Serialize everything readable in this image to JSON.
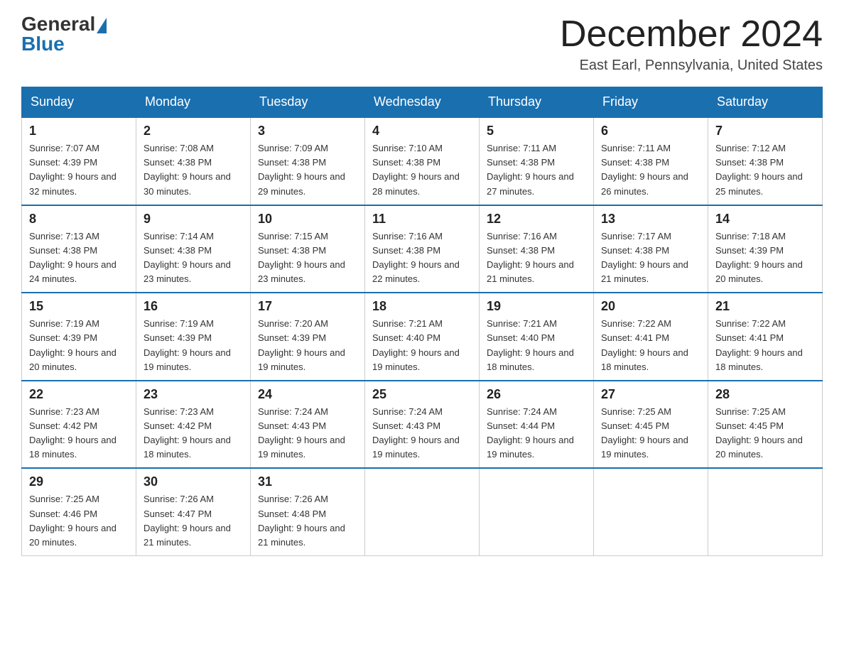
{
  "logo": {
    "general": "General",
    "blue": "Blue"
  },
  "title": "December 2024",
  "location": "East Earl, Pennsylvania, United States",
  "days_of_week": [
    "Sunday",
    "Monday",
    "Tuesday",
    "Wednesday",
    "Thursday",
    "Friday",
    "Saturday"
  ],
  "weeks": [
    [
      {
        "day": "1",
        "sunrise": "7:07 AM",
        "sunset": "4:39 PM",
        "daylight": "9 hours and 32 minutes."
      },
      {
        "day": "2",
        "sunrise": "7:08 AM",
        "sunset": "4:38 PM",
        "daylight": "9 hours and 30 minutes."
      },
      {
        "day": "3",
        "sunrise": "7:09 AM",
        "sunset": "4:38 PM",
        "daylight": "9 hours and 29 minutes."
      },
      {
        "day": "4",
        "sunrise": "7:10 AM",
        "sunset": "4:38 PM",
        "daylight": "9 hours and 28 minutes."
      },
      {
        "day": "5",
        "sunrise": "7:11 AM",
        "sunset": "4:38 PM",
        "daylight": "9 hours and 27 minutes."
      },
      {
        "day": "6",
        "sunrise": "7:11 AM",
        "sunset": "4:38 PM",
        "daylight": "9 hours and 26 minutes."
      },
      {
        "day": "7",
        "sunrise": "7:12 AM",
        "sunset": "4:38 PM",
        "daylight": "9 hours and 25 minutes."
      }
    ],
    [
      {
        "day": "8",
        "sunrise": "7:13 AM",
        "sunset": "4:38 PM",
        "daylight": "9 hours and 24 minutes."
      },
      {
        "day": "9",
        "sunrise": "7:14 AM",
        "sunset": "4:38 PM",
        "daylight": "9 hours and 23 minutes."
      },
      {
        "day": "10",
        "sunrise": "7:15 AM",
        "sunset": "4:38 PM",
        "daylight": "9 hours and 23 minutes."
      },
      {
        "day": "11",
        "sunrise": "7:16 AM",
        "sunset": "4:38 PM",
        "daylight": "9 hours and 22 minutes."
      },
      {
        "day": "12",
        "sunrise": "7:16 AM",
        "sunset": "4:38 PM",
        "daylight": "9 hours and 21 minutes."
      },
      {
        "day": "13",
        "sunrise": "7:17 AM",
        "sunset": "4:38 PM",
        "daylight": "9 hours and 21 minutes."
      },
      {
        "day": "14",
        "sunrise": "7:18 AM",
        "sunset": "4:39 PM",
        "daylight": "9 hours and 20 minutes."
      }
    ],
    [
      {
        "day": "15",
        "sunrise": "7:19 AM",
        "sunset": "4:39 PM",
        "daylight": "9 hours and 20 minutes."
      },
      {
        "day": "16",
        "sunrise": "7:19 AM",
        "sunset": "4:39 PM",
        "daylight": "9 hours and 19 minutes."
      },
      {
        "day": "17",
        "sunrise": "7:20 AM",
        "sunset": "4:39 PM",
        "daylight": "9 hours and 19 minutes."
      },
      {
        "day": "18",
        "sunrise": "7:21 AM",
        "sunset": "4:40 PM",
        "daylight": "9 hours and 19 minutes."
      },
      {
        "day": "19",
        "sunrise": "7:21 AM",
        "sunset": "4:40 PM",
        "daylight": "9 hours and 18 minutes."
      },
      {
        "day": "20",
        "sunrise": "7:22 AM",
        "sunset": "4:41 PM",
        "daylight": "9 hours and 18 minutes."
      },
      {
        "day": "21",
        "sunrise": "7:22 AM",
        "sunset": "4:41 PM",
        "daylight": "9 hours and 18 minutes."
      }
    ],
    [
      {
        "day": "22",
        "sunrise": "7:23 AM",
        "sunset": "4:42 PM",
        "daylight": "9 hours and 18 minutes."
      },
      {
        "day": "23",
        "sunrise": "7:23 AM",
        "sunset": "4:42 PM",
        "daylight": "9 hours and 18 minutes."
      },
      {
        "day": "24",
        "sunrise": "7:24 AM",
        "sunset": "4:43 PM",
        "daylight": "9 hours and 19 minutes."
      },
      {
        "day": "25",
        "sunrise": "7:24 AM",
        "sunset": "4:43 PM",
        "daylight": "9 hours and 19 minutes."
      },
      {
        "day": "26",
        "sunrise": "7:24 AM",
        "sunset": "4:44 PM",
        "daylight": "9 hours and 19 minutes."
      },
      {
        "day": "27",
        "sunrise": "7:25 AM",
        "sunset": "4:45 PM",
        "daylight": "9 hours and 19 minutes."
      },
      {
        "day": "28",
        "sunrise": "7:25 AM",
        "sunset": "4:45 PM",
        "daylight": "9 hours and 20 minutes."
      }
    ],
    [
      {
        "day": "29",
        "sunrise": "7:25 AM",
        "sunset": "4:46 PM",
        "daylight": "9 hours and 20 minutes."
      },
      {
        "day": "30",
        "sunrise": "7:26 AM",
        "sunset": "4:47 PM",
        "daylight": "9 hours and 21 minutes."
      },
      {
        "day": "31",
        "sunrise": "7:26 AM",
        "sunset": "4:48 PM",
        "daylight": "9 hours and 21 minutes."
      },
      null,
      null,
      null,
      null
    ]
  ]
}
